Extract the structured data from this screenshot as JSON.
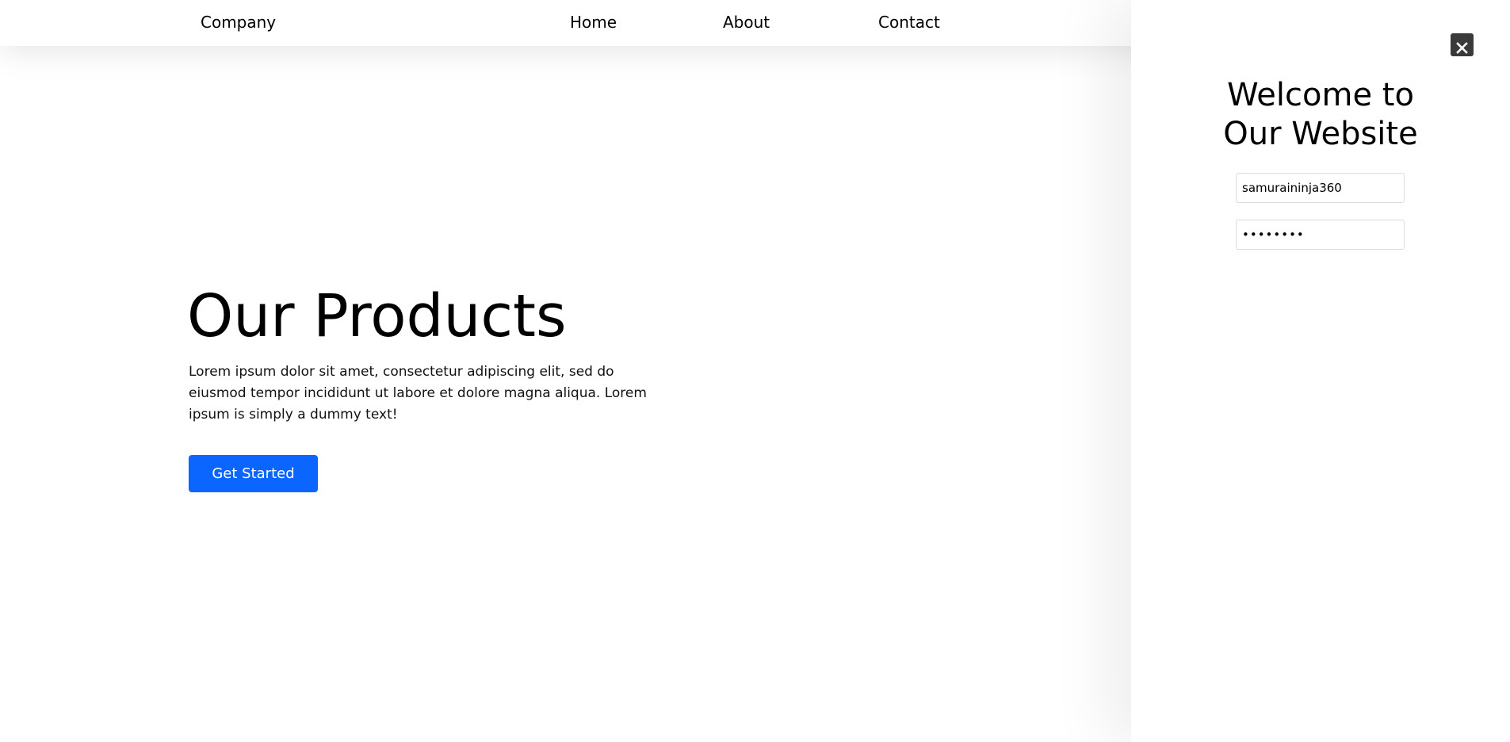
{
  "navbar": {
    "brand": "Company",
    "links": [
      {
        "label": "Home"
      },
      {
        "label": "About"
      },
      {
        "label": "Contact"
      }
    ]
  },
  "hero": {
    "title": "Our Products",
    "text": "Lorem ipsum dolor sit amet, consectetur adipiscing elit, sed do eiusmod tempor incididunt ut labore et dolore magna aliqua. Lorem ipsum is simply a dummy text!",
    "cta_label": "Get Started"
  },
  "panel": {
    "title_line1": "Welcome to",
    "title_line2": "Our Website",
    "username_value": "samuraininja360",
    "password_value": "password",
    "close_icon": "close-icon"
  },
  "colors": {
    "accent": "#0a66ff",
    "close_button_bg": "#3a3a3a",
    "background": "#ffffff",
    "text": "#000000"
  }
}
